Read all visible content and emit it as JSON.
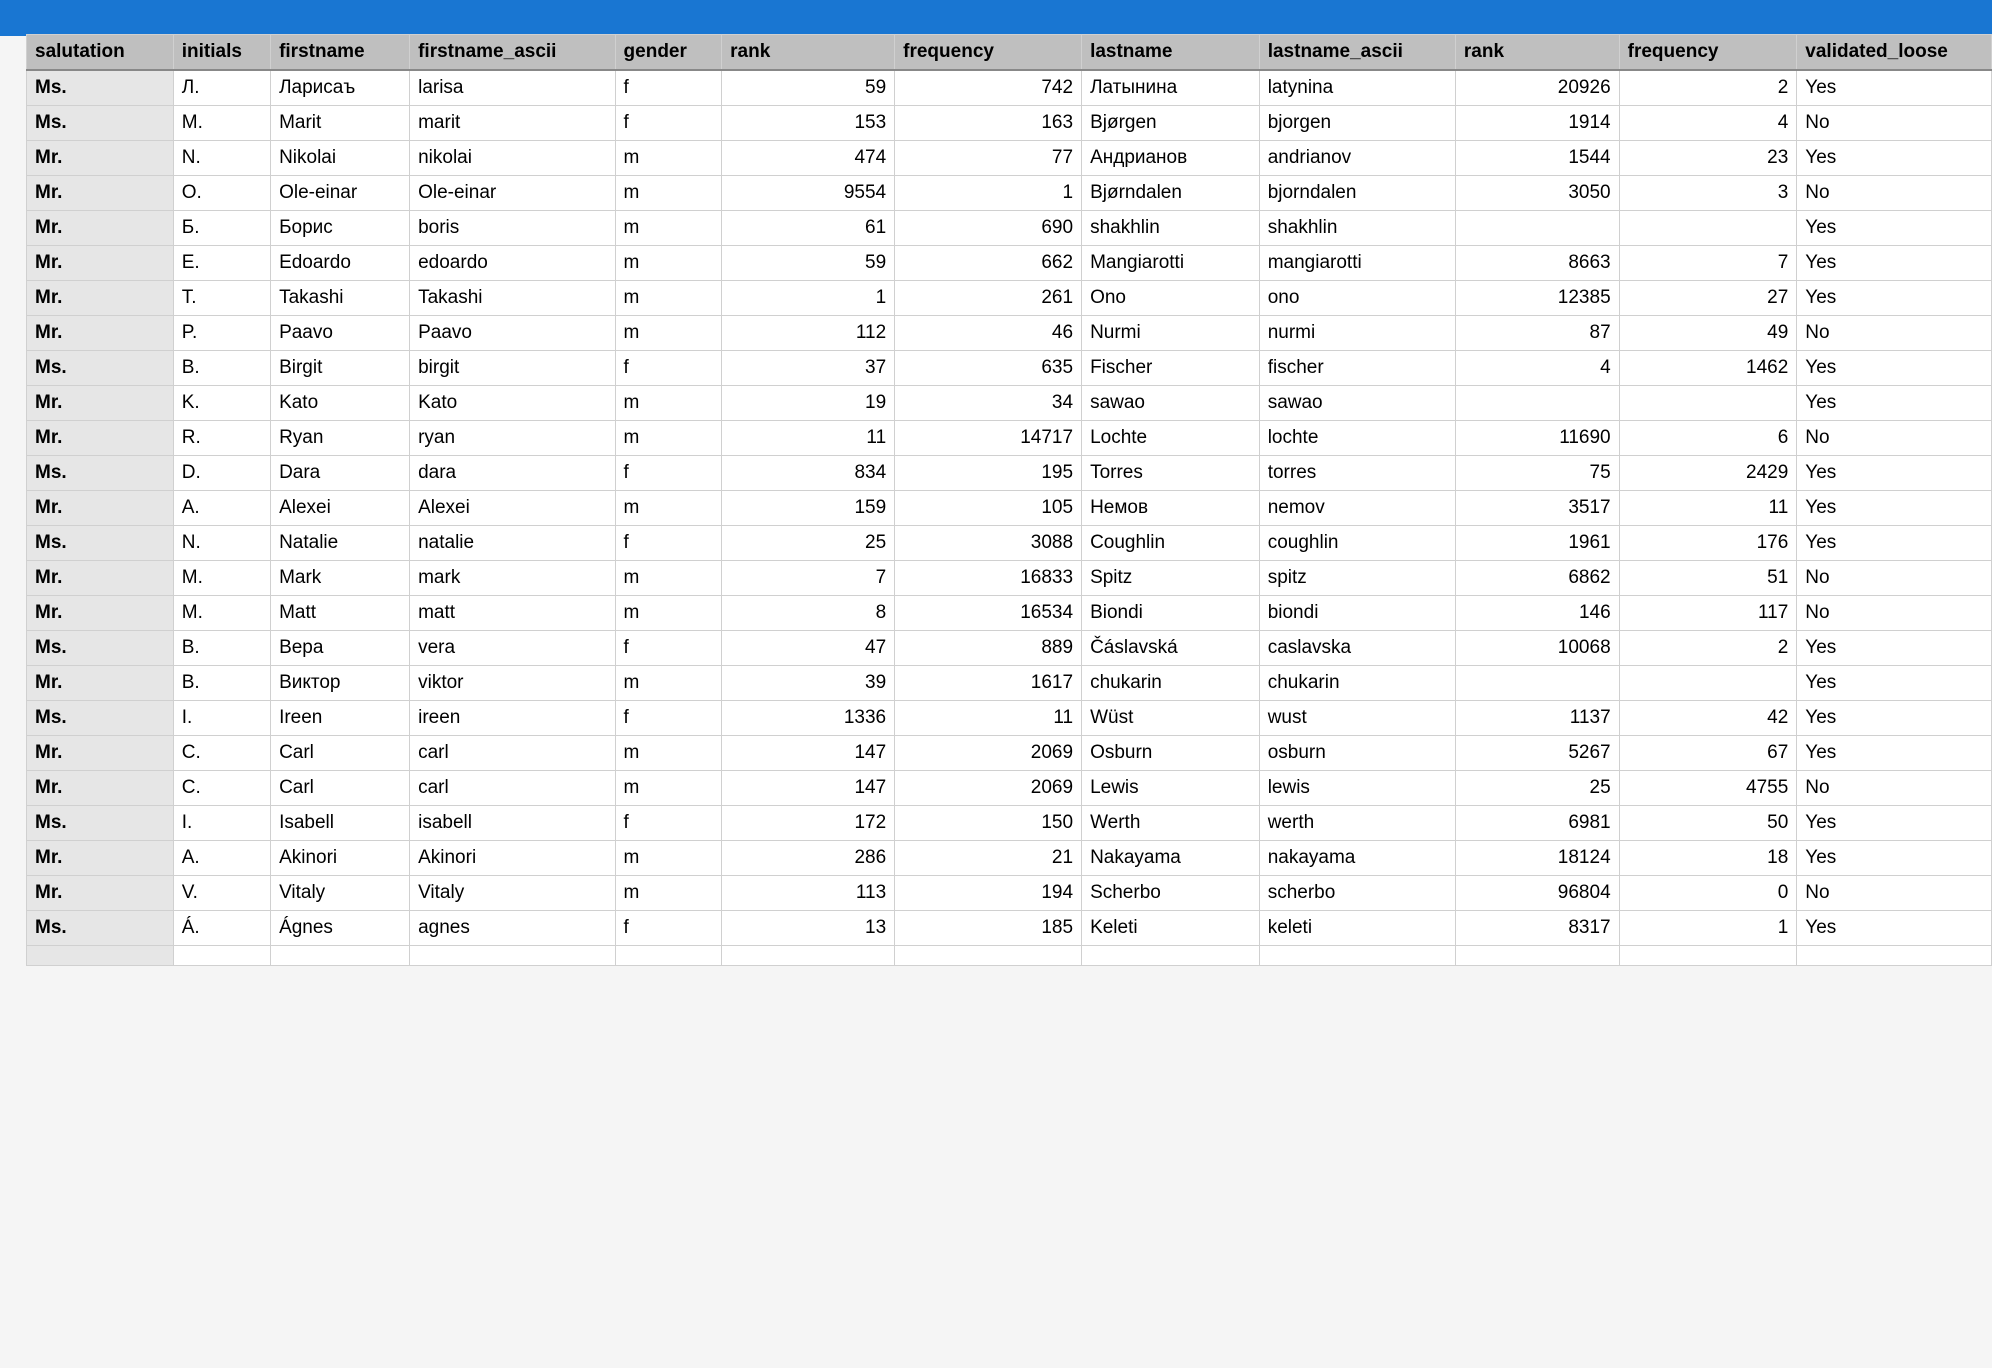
{
  "columns": [
    {
      "key": "salutation",
      "label": "salutation",
      "align": "left"
    },
    {
      "key": "initials",
      "label": "initials",
      "align": "left"
    },
    {
      "key": "firstname",
      "label": "firstname",
      "align": "left"
    },
    {
      "key": "firstname_ascii",
      "label": "firstname_ascii",
      "align": "left"
    },
    {
      "key": "gender",
      "label": "gender",
      "align": "left"
    },
    {
      "key": "rank1",
      "label": "rank",
      "align": "right"
    },
    {
      "key": "frequency1",
      "label": "frequency",
      "align": "right"
    },
    {
      "key": "lastname",
      "label": "lastname",
      "align": "left"
    },
    {
      "key": "lastname_ascii",
      "label": "lastname_ascii",
      "align": "left"
    },
    {
      "key": "rank2",
      "label": "rank",
      "align": "right"
    },
    {
      "key": "frequency2",
      "label": "frequency",
      "align": "right"
    },
    {
      "key": "validated_loose",
      "label": "validated_loose",
      "align": "left"
    }
  ],
  "rows": [
    {
      "salutation": "Ms.",
      "initials": "Л.",
      "firstname": "Ларисаъ",
      "firstname_ascii": "larisa",
      "gender": "f",
      "rank1": "59",
      "frequency1": "742",
      "lastname": "Латынина",
      "lastname_ascii": "latynina",
      "rank2": "20926",
      "frequency2": "2",
      "validated_loose": "Yes"
    },
    {
      "salutation": "Ms.",
      "initials": "M.",
      "firstname": "Marit",
      "firstname_ascii": "marit",
      "gender": "f",
      "rank1": "153",
      "frequency1": "163",
      "lastname": "Bjørgen",
      "lastname_ascii": "bjorgen",
      "rank2": "1914",
      "frequency2": "4",
      "validated_loose": "No"
    },
    {
      "salutation": "Mr.",
      "initials": "N.",
      "firstname": "Nikolai",
      "firstname_ascii": "nikolai",
      "gender": "m",
      "rank1": "474",
      "frequency1": "77",
      "lastname": "Андрианов",
      "lastname_ascii": "andrianov",
      "rank2": "1544",
      "frequency2": "23",
      "validated_loose": "Yes"
    },
    {
      "salutation": "Mr.",
      "initials": "O.",
      "firstname": "Ole-einar",
      "firstname_ascii": "Ole-einar",
      "gender": "m",
      "rank1": "9554",
      "frequency1": "1",
      "lastname": "Bjørndalen",
      "lastname_ascii": "bjorndalen",
      "rank2": "3050",
      "frequency2": "3",
      "validated_loose": "No"
    },
    {
      "salutation": "Mr.",
      "initials": "Б.",
      "firstname": "Борис",
      "firstname_ascii": "boris",
      "gender": "m",
      "rank1": "61",
      "frequency1": "690",
      "lastname": "shakhlin",
      "lastname_ascii": "shakhlin",
      "rank2": "",
      "frequency2": "",
      "validated_loose": "Yes"
    },
    {
      "salutation": "Mr.",
      "initials": "E.",
      "firstname": "Edoardo",
      "firstname_ascii": "edoardo",
      "gender": "m",
      "rank1": "59",
      "frequency1": "662",
      "lastname": "Mangiarotti",
      "lastname_ascii": "mangiarotti",
      "rank2": "8663",
      "frequency2": "7",
      "validated_loose": "Yes"
    },
    {
      "salutation": "Mr.",
      "initials": "T.",
      "firstname": "Takashi",
      "firstname_ascii": "Takashi",
      "gender": "m",
      "rank1": "1",
      "frequency1": "261",
      "lastname": "Ono",
      "lastname_ascii": "ono",
      "rank2": "12385",
      "frequency2": "27",
      "validated_loose": "Yes"
    },
    {
      "salutation": "Mr.",
      "initials": "P.",
      "firstname": "Paavo",
      "firstname_ascii": "Paavo",
      "gender": "m",
      "rank1": "112",
      "frequency1": "46",
      "lastname": "Nurmi",
      "lastname_ascii": "nurmi",
      "rank2": "87",
      "frequency2": "49",
      "validated_loose": "No"
    },
    {
      "salutation": "Ms.",
      "initials": "B.",
      "firstname": "Birgit",
      "firstname_ascii": "birgit",
      "gender": "f",
      "rank1": "37",
      "frequency1": "635",
      "lastname": "Fischer",
      "lastname_ascii": "fischer",
      "rank2": "4",
      "frequency2": "1462",
      "validated_loose": "Yes"
    },
    {
      "salutation": "Mr.",
      "initials": "K.",
      "firstname": "Kato",
      "firstname_ascii": "Kato",
      "gender": "m",
      "rank1": "19",
      "frequency1": "34",
      "lastname": "sawao",
      "lastname_ascii": "sawao",
      "rank2": "",
      "frequency2": "",
      "validated_loose": "Yes"
    },
    {
      "salutation": "Mr.",
      "initials": "R.",
      "firstname": "Ryan",
      "firstname_ascii": "ryan",
      "gender": "m",
      "rank1": "11",
      "frequency1": "14717",
      "lastname": "Lochte",
      "lastname_ascii": "lochte",
      "rank2": "11690",
      "frequency2": "6",
      "validated_loose": "No"
    },
    {
      "salutation": "Ms.",
      "initials": "D.",
      "firstname": "Dara",
      "firstname_ascii": "dara",
      "gender": "f",
      "rank1": "834",
      "frequency1": "195",
      "lastname": "Torres",
      "lastname_ascii": "torres",
      "rank2": "75",
      "frequency2": "2429",
      "validated_loose": "Yes"
    },
    {
      "salutation": "Mr.",
      "initials": "A.",
      "firstname": "Alexei",
      "firstname_ascii": "Alexei",
      "gender": "m",
      "rank1": "159",
      "frequency1": "105",
      "lastname": "Немов",
      "lastname_ascii": "nemov",
      "rank2": "3517",
      "frequency2": "11",
      "validated_loose": "Yes"
    },
    {
      "salutation": "Ms.",
      "initials": "N.",
      "firstname": "Natalie",
      "firstname_ascii": "natalie",
      "gender": "f",
      "rank1": "25",
      "frequency1": "3088",
      "lastname": "Coughlin",
      "lastname_ascii": "coughlin",
      "rank2": "1961",
      "frequency2": "176",
      "validated_loose": "Yes"
    },
    {
      "salutation": "Mr.",
      "initials": "M.",
      "firstname": "Mark",
      "firstname_ascii": "mark",
      "gender": "m",
      "rank1": "7",
      "frequency1": "16833",
      "lastname": "Spitz",
      "lastname_ascii": "spitz",
      "rank2": "6862",
      "frequency2": "51",
      "validated_loose": "No"
    },
    {
      "salutation": "Mr.",
      "initials": "M.",
      "firstname": "Matt",
      "firstname_ascii": "matt",
      "gender": "m",
      "rank1": "8",
      "frequency1": "16534",
      "lastname": "Biondi",
      "lastname_ascii": "biondi",
      "rank2": "146",
      "frequency2": "117",
      "validated_loose": "No"
    },
    {
      "salutation": "Ms.",
      "initials": "В.",
      "firstname": "Вера",
      "firstname_ascii": "vera",
      "gender": "f",
      "rank1": "47",
      "frequency1": "889",
      "lastname": "Čáslavská",
      "lastname_ascii": "caslavska",
      "rank2": "10068",
      "frequency2": "2",
      "validated_loose": "Yes"
    },
    {
      "salutation": "Mr.",
      "initials": "В.",
      "firstname": "Виктор",
      "firstname_ascii": "viktor",
      "gender": "m",
      "rank1": "39",
      "frequency1": "1617",
      "lastname": "chukarin",
      "lastname_ascii": "chukarin",
      "rank2": "",
      "frequency2": "",
      "validated_loose": "Yes"
    },
    {
      "salutation": "Ms.",
      "initials": "I.",
      "firstname": "Ireen",
      "firstname_ascii": "ireen",
      "gender": "f",
      "rank1": "1336",
      "frequency1": "11",
      "lastname": "Wüst",
      "lastname_ascii": "wust",
      "rank2": "1137",
      "frequency2": "42",
      "validated_loose": "Yes"
    },
    {
      "salutation": "Mr.",
      "initials": "C.",
      "firstname": "Carl",
      "firstname_ascii": "carl",
      "gender": "m",
      "rank1": "147",
      "frequency1": "2069",
      "lastname": "Osburn",
      "lastname_ascii": "osburn",
      "rank2": "5267",
      "frequency2": "67",
      "validated_loose": "Yes"
    },
    {
      "salutation": "Mr.",
      "initials": "C.",
      "firstname": "Carl",
      "firstname_ascii": "carl",
      "gender": "m",
      "rank1": "147",
      "frequency1": "2069",
      "lastname": "Lewis",
      "lastname_ascii": "lewis",
      "rank2": "25",
      "frequency2": "4755",
      "validated_loose": "No"
    },
    {
      "salutation": "Ms.",
      "initials": "I.",
      "firstname": "Isabell",
      "firstname_ascii": "isabell",
      "gender": "f",
      "rank1": "172",
      "frequency1": "150",
      "lastname": "Werth",
      "lastname_ascii": "werth",
      "rank2": "6981",
      "frequency2": "50",
      "validated_loose": "Yes"
    },
    {
      "salutation": "Mr.",
      "initials": "A.",
      "firstname": "Akinori",
      "firstname_ascii": "Akinori",
      "gender": "m",
      "rank1": "286",
      "frequency1": "21",
      "lastname": "Nakayama",
      "lastname_ascii": "nakayama",
      "rank2": "18124",
      "frequency2": "18",
      "validated_loose": "Yes"
    },
    {
      "salutation": "Mr.",
      "initials": "V.",
      "firstname": "Vitaly",
      "firstname_ascii": "Vitaly",
      "gender": "m",
      "rank1": "113",
      "frequency1": "194",
      "lastname": "Scherbo",
      "lastname_ascii": "scherbo",
      "rank2": "96804",
      "frequency2": "0",
      "validated_loose": "No"
    },
    {
      "salutation": "Ms.",
      "initials": "Á.",
      "firstname": "Ágnes",
      "firstname_ascii": "agnes",
      "gender": "f",
      "rank1": "13",
      "frequency1": "185",
      "lastname": "Keleti",
      "lastname_ascii": "keleti",
      "rank2": "8317",
      "frequency2": "1",
      "validated_loose": "Yes"
    }
  ]
}
